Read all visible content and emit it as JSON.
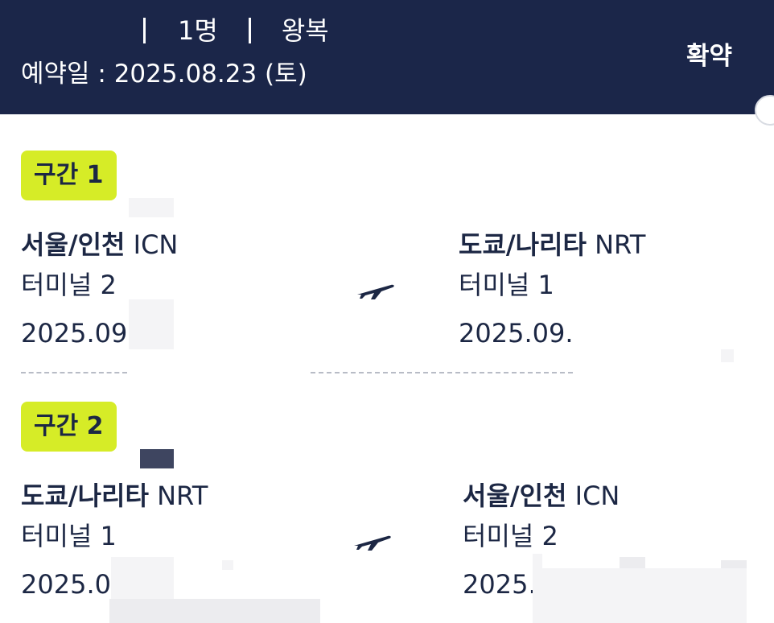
{
  "header": {
    "passengers": "1명",
    "trip_type": "왕복",
    "reservation_date": "예약일 : 2025.08.23 (토)",
    "status": "확약"
  },
  "segments": [
    {
      "badge": "구간 1",
      "departure": {
        "city": "서울/인천",
        "code": "ICN",
        "terminal": "터미널 2",
        "date": "2025.09"
      },
      "arrival": {
        "city": "도쿄/나리타",
        "code": "NRT",
        "terminal": "터미널 1",
        "date": "2025.09."
      }
    },
    {
      "badge": "구간 2",
      "departure": {
        "city": "도쿄/나리타",
        "code": "NRT",
        "terminal": "터미널 1",
        "date": "2025.0"
      },
      "arrival": {
        "city": "서울/인천",
        "code": "ICN",
        "terminal": "터미널 2",
        "date": "2025."
      }
    }
  ],
  "icons": {
    "flight": "airplane-icon"
  },
  "colors": {
    "header_bg": "#1b2649",
    "badge_bg": "#d6ec27",
    "text": "#1c2744"
  }
}
